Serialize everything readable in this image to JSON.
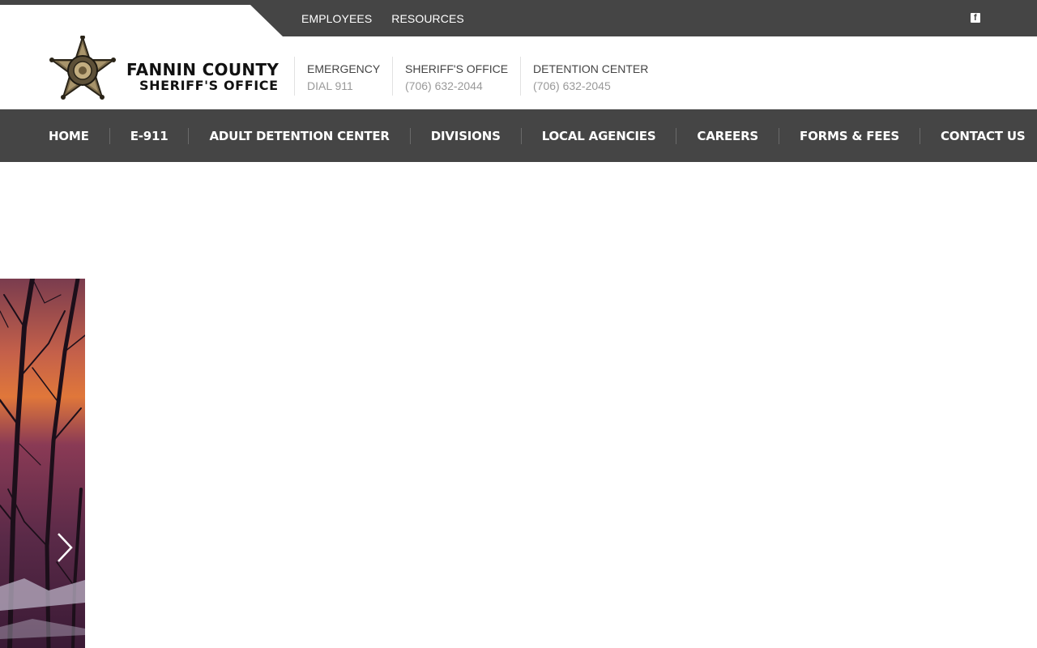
{
  "utility_nav": {
    "links": [
      "EMPLOYEES",
      "RESOURCES"
    ],
    "social_icon": "facebook-icon"
  },
  "logo": {
    "line1": "FANNIN COUNTY",
    "line2": "SHERIFF'S OFFICE"
  },
  "contacts": [
    {
      "label": "EMERGENCY",
      "value": "DIAL 911"
    },
    {
      "label": "SHERIFF'S OFFICE",
      "value": "(706) 632-2044"
    },
    {
      "label": "DETENTION CENTER",
      "value": "(706) 632-2045"
    }
  ],
  "main_nav": {
    "items": [
      "HOME",
      "E-911",
      "ADULT DETENTION CENTER",
      "DIVISIONS",
      "LOCAL AGENCIES",
      "CAREERS",
      "FORMS & FEES",
      "CONTACT US"
    ]
  },
  "hero": {
    "next_icon": "chevron-right-icon"
  },
  "colors": {
    "bar": "#454545",
    "white": "#ffffff"
  }
}
